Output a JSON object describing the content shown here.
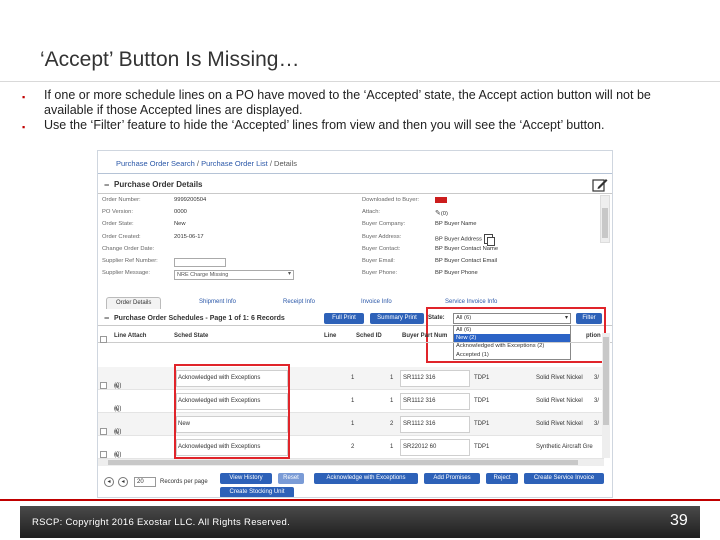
{
  "slide": {
    "title": "‘Accept’ Button Is Missing…",
    "bullets": [
      "If one or more schedule lines on a PO have moved to the ‘Accepted’ state, the Accept action button will not be available if those Accepted lines are displayed.",
      "Use the ‘Filter’ feature to hide the ‘Accepted’ lines from view and then you will see the ‘Accept’ button."
    ],
    "footer_copyright": "RSCP: Copyright 2016 Exostar LLC. All Rights Reserved.",
    "page_number": "39"
  },
  "screenshot": {
    "breadcrumb": {
      "link1": "Purchase Order Search",
      "sep": " / ",
      "link2": "Purchase Order List",
      "sep2": " / ",
      "current": "Details"
    },
    "po_details": {
      "title": "Purchase Order Details",
      "left": [
        {
          "label": "Order Number:",
          "value": "9999200504"
        },
        {
          "label": "PO Version:",
          "value": "0000"
        },
        {
          "label": "Order State:",
          "value": "New"
        },
        {
          "label": "Order Created:",
          "value": "2015-06-17"
        },
        {
          "label": "Change Order Date:",
          "value": ""
        },
        {
          "label": "Supplier Ref Number:",
          "value": ""
        },
        {
          "label": "Supplier Message:",
          "value": "NRE Charge Missing"
        }
      ],
      "right": [
        {
          "label": "Downloaded to Buyer:",
          "value": ""
        },
        {
          "label": "Attach:",
          "value": "(0)"
        },
        {
          "label": "Buyer Company:",
          "value": "BP Buyer Name"
        },
        {
          "label": "Buyer Address:",
          "value": "BP Buyer Address"
        },
        {
          "label": "Buyer Contact:",
          "value": "BP Buyer Contact Name"
        },
        {
          "label": "Buyer Email:",
          "value": "BP Buyer Contact Email"
        },
        {
          "label": "Buyer Phone:",
          "value": "BP Buyer Phone"
        }
      ]
    },
    "tabs": [
      "Order Details",
      "Shipment Info",
      "Receipt Info",
      "Invoice Info",
      "Service Invoice Info"
    ],
    "schedules": {
      "title": "Purchase Order Schedules - Page 1 of 1: 6 Records",
      "full_print": "Full Print",
      "summary_print": "Summary Print",
      "state_label": "State:",
      "state_value": "All (6)",
      "filter": "Filter",
      "state_options": [
        "All (6)",
        "New (2)",
        "Acknowledged with Exceptions (2)",
        "Accepted (1)"
      ]
    },
    "table": {
      "headers": [
        "Line Attach",
        "Sched State",
        "Line",
        "Sched ID",
        "Buyer Part Num",
        "ption"
      ],
      "rows": [
        {
          "attach": "(0)",
          "state": "Acknowledged with Exceptions",
          "line": "1",
          "sched": "1",
          "part": "SR1112 316",
          "c1": "TDP1",
          "desc": "Solid Rivet Nickel",
          "x": "3/"
        },
        {
          "attach": "(0)",
          "state": "Acknowledged with Exceptions",
          "line": "1",
          "sched": "1",
          "part": "SR1112 316",
          "c1": "TDP1",
          "desc": "Solid Rivet Nickel",
          "x": "3/"
        },
        {
          "attach": "(0)",
          "state": "New",
          "line": "1",
          "sched": "2",
          "part": "SR1112 316",
          "c1": "TDP1",
          "desc": "Solid Rivet Nickel",
          "x": "3/"
        },
        {
          "attach": "(0)",
          "state": "Acknowledged with Exceptions",
          "line": "2",
          "sched": "1",
          "part": "SR22012 60",
          "c1": "TDP1",
          "desc": "Synthetic Aircraft Gre",
          "x": ""
        }
      ]
    },
    "pager": {
      "per_page": "20",
      "label": "Records per page"
    },
    "actions": [
      "View History",
      "Reset",
      "Acknowledge with Exceptions",
      "Add Promises",
      "Reject",
      "Create Service Invoice",
      "Create Stocking Unit"
    ]
  }
}
